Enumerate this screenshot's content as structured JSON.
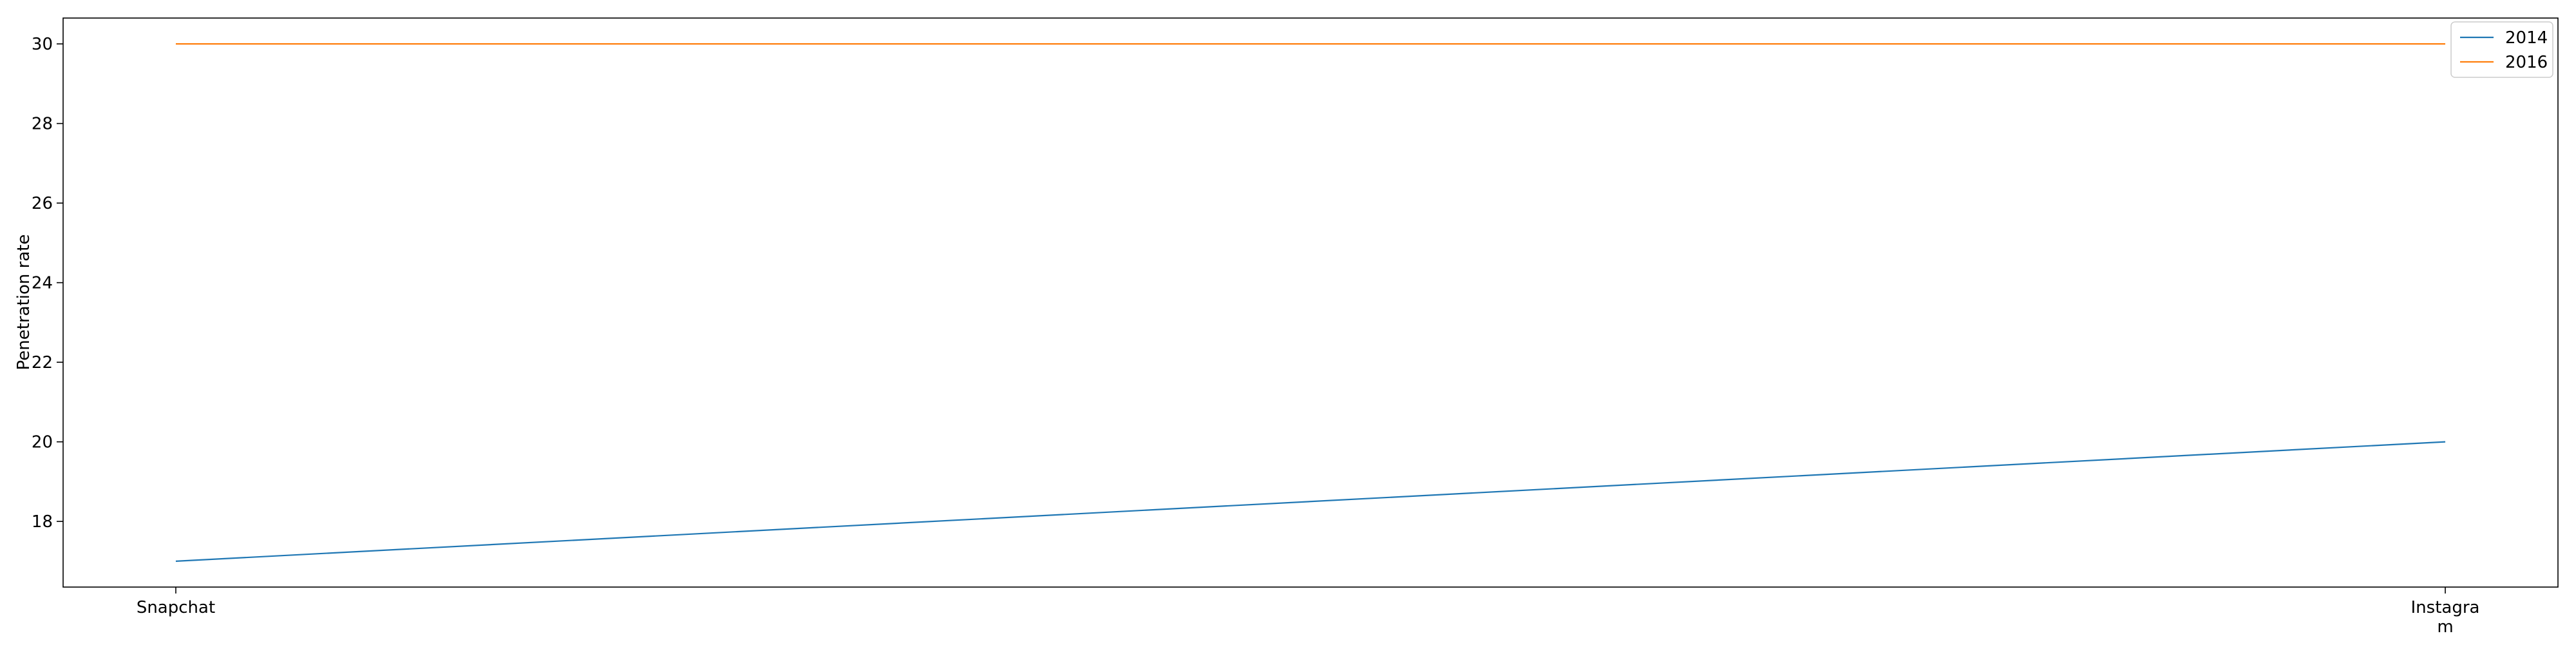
{
  "chart_data": {
    "type": "line",
    "title": "",
    "xlabel": "",
    "ylabel": "Penetration rate",
    "categories": [
      "Snapchat",
      "Instagram"
    ],
    "category_display": [
      [
        "Snapchat"
      ],
      [
        "Instagra",
        "m"
      ]
    ],
    "series": [
      {
        "name": "2014",
        "values": [
          17,
          20
        ],
        "color": "#1f77b4"
      },
      {
        "name": "2016",
        "values": [
          30,
          30
        ],
        "color": "#ff7f0e"
      }
    ],
    "ylim": [
      16.35,
      30.65
    ],
    "yticks": [
      18,
      20,
      22,
      24,
      26,
      28,
      30
    ],
    "grid": false,
    "legend_position": "top-right"
  }
}
